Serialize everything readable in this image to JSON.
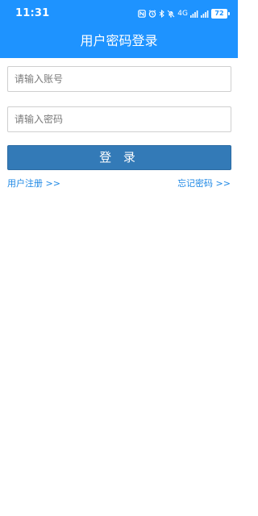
{
  "status_bar": {
    "time": "11:31",
    "network_label": "4G",
    "battery_level": "72",
    "icons": [
      "nfc-icon",
      "alarm-icon",
      "bluetooth-icon",
      "mute-icon",
      "wifi-signal-icon",
      "cellular-signal-icon",
      "battery-icon"
    ]
  },
  "header": {
    "title": "用户密码登录"
  },
  "form": {
    "account_placeholder": "请输入账号",
    "password_placeholder": "请输入密码",
    "login_label": "登 录"
  },
  "links": {
    "register_label": "用户注册 >>",
    "forgot_label": "忘记密码 >>"
  },
  "colors": {
    "header_background": "#1E93FF",
    "button_background": "#337AB7",
    "link_color": "#1E88E5",
    "field_border": "#CFCFCF"
  }
}
